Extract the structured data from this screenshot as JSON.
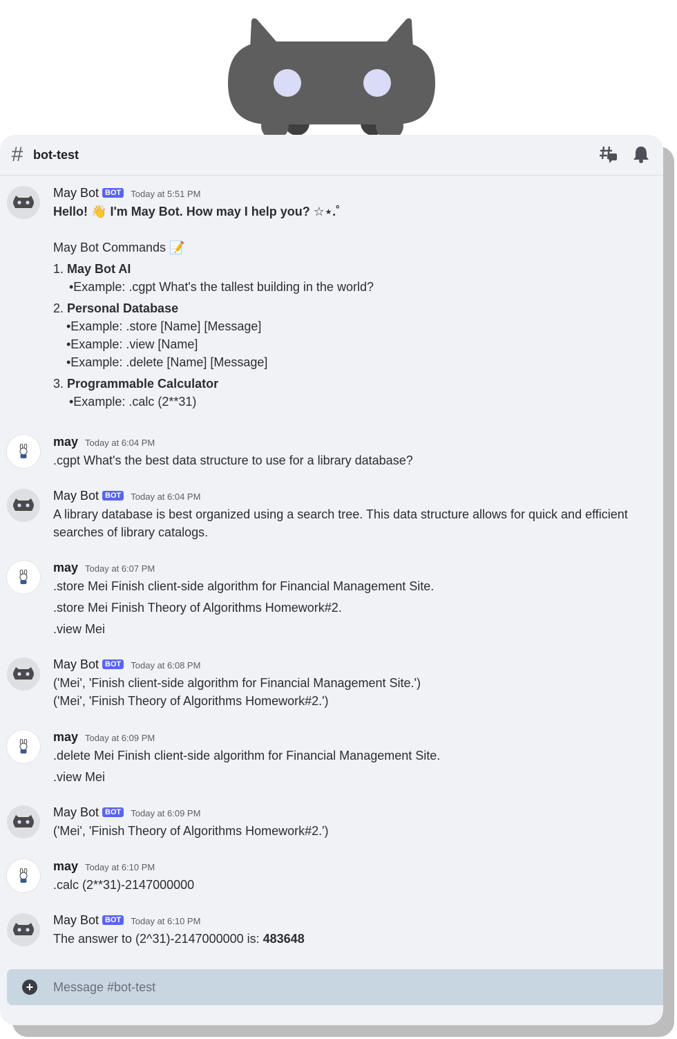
{
  "channel": {
    "name": "bot-test"
  },
  "composer": {
    "placeholder": "Message #bot-test"
  },
  "bot_badge": "BOT",
  "messages": [
    {
      "author": "May Bot",
      "time": "Today at 5:51 PM",
      "greeting_a": "Hello! ",
      "greeting_emoji": "👋",
      "greeting_b": " I'm May Bot. How may I help you? ☆⋆.˚",
      "commands_title": "May Bot Commands ",
      "commands_emoji": "📝",
      "c1_num": "1. ",
      "c1_title": "May Bot AI",
      "c1_ex1": "•Example: .cgpt What's the tallest building in the world?",
      "c2_num": "2. ",
      "c2_title": "Personal Database",
      "c2_ex1": "•Example: .store [Name] [Message]",
      "c2_ex2": "•Example: .view [Name]",
      "c2_ex3": "•Example: .delete [Name] [Message]",
      "c3_num": "3. ",
      "c3_title": "Programmable Calculator",
      "c3_ex1": "•Example: .calc (2**31)"
    },
    {
      "author": "may",
      "time": "Today at 6:04 PM",
      "l1": ".cgpt What's the best data structure to use for a library database?"
    },
    {
      "author": "May Bot",
      "time": "Today at 6:04 PM",
      "l1": "A library database is best organized using a search tree. This data structure allows for quick and efficient",
      "l2": "searches of library catalogs."
    },
    {
      "author": "may",
      "time": "Today at 6:07 PM",
      "l1": ".store Mei Finish client-side algorithm for Financial Management Site.",
      "l2": ".store Mei Finish Theory of Algorithms Homework#2.",
      "l3": ".view Mei"
    },
    {
      "author": "May Bot",
      "time": "Today at 6:08 PM",
      "l1": "('Mei', 'Finish client-side algorithm for Financial Management Site.')",
      "l2": "('Mei', 'Finish Theory of Algorithms Homework#2.')"
    },
    {
      "author": "may",
      "time": "Today at 6:09 PM",
      "l1": ".delete Mei Finish client-side algorithm for Financial Management Site.",
      "l2": ".view Mei"
    },
    {
      "author": "May Bot",
      "time": "Today at 6:09 PM",
      "l1": "('Mei', 'Finish Theory of Algorithms Homework#2.')"
    },
    {
      "author": "may",
      "time": "Today at 6:10 PM",
      "l1": ".calc (2**31)-2147000000"
    },
    {
      "author": "May Bot",
      "time": "Today at 6:10 PM",
      "l1": "The answer to (2^31)-2147000000 is: ",
      "l1_bold": "483648"
    }
  ]
}
